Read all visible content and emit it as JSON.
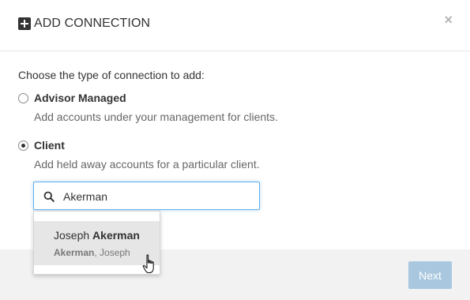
{
  "header": {
    "title": "ADD CONNECTION",
    "close_label": "×"
  },
  "body": {
    "prompt": "Choose the type of connection to add:",
    "options": [
      {
        "label": "Advisor Managed",
        "description": "Add accounts under your management for clients.",
        "checked": false
      },
      {
        "label": "Client",
        "description": "Add held away accounts for a particular client.",
        "checked": true
      }
    ]
  },
  "search": {
    "value": "Akerman",
    "icon": "search-icon"
  },
  "dropdown": {
    "items": [
      {
        "first_name": "Joseph ",
        "last_name": "Akerman",
        "sub_last": "Akerman",
        "sub_rest": ", Joseph"
      }
    ]
  },
  "footer": {
    "next_label": "Next"
  },
  "colors": {
    "accent_disabled": "#a9c8e0",
    "focus_border": "#66afe9",
    "footer_bg": "#f2f2f2"
  }
}
